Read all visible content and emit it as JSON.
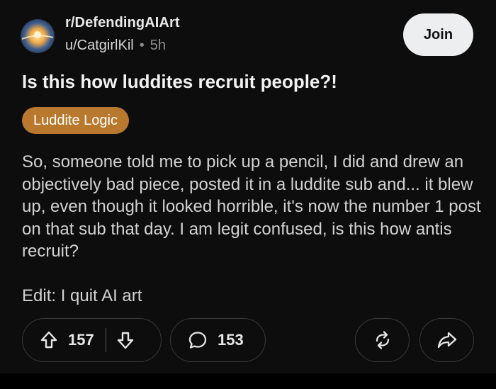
{
  "post": {
    "subreddit": "r/DefendingAIArt",
    "author": "u/CatgirlKil",
    "separator": "•",
    "age": "5h",
    "join_label": "Join",
    "title": "Is this how luddites recruit people?!",
    "flair": "Luddite Logic",
    "body_paragraph": "So, someone told me to pick up a pencil, I did and drew an objectively bad piece, posted it in a luddite sub and... it blew up, even though it looked horrible, it's now the number 1 post on that sub that day. I am legit confused, is this how antis recruit?",
    "body_edit": "Edit: I quit AI art"
  },
  "actions": {
    "upvotes": "157",
    "comments": "153"
  },
  "colors": {
    "background": "#0d0d0e",
    "flair": "#b8792e",
    "join_button": "#eceef0",
    "pill_border": "#3a3a3c"
  },
  "icons": {
    "avatar": "community-avatar",
    "upvote": "arrow-up-icon",
    "downvote": "arrow-down-icon",
    "comment": "speech-bubble-icon",
    "award": "swap-arrows-icon",
    "share": "share-arrow-icon"
  }
}
